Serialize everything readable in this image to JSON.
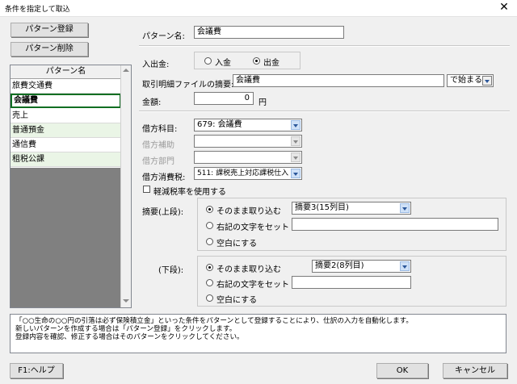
{
  "window": {
    "title": "条件を指定して取込",
    "close_glyph": "✕"
  },
  "left": {
    "register_button": "パターン登録",
    "delete_button": "パターン削除",
    "list_header": "パターン名",
    "items": [
      "旅費交通費",
      "会議費",
      "売上",
      "普通預金",
      "通信費",
      "租税公課"
    ],
    "selected_index": 1
  },
  "form": {
    "pattern_name_label": "パターン名:",
    "pattern_name_value": "会議費",
    "inout_label": "入出金:",
    "in_label": "入金",
    "out_label": "出金",
    "inout_selected": "出金",
    "summary_label": "取引明細ファイルの摘要:",
    "summary_value": "会議費",
    "match_value": "で始まる",
    "amount_label": "金額:",
    "amount_value": "0",
    "amount_unit": "円",
    "debit_account_label": "借方科目:",
    "debit_account_value": "679: 会議費",
    "debit_sub_label": "借方補助",
    "debit_sub_value": "",
    "debit_dept_label": "借方部門",
    "debit_dept_value": "",
    "debit_tax_label": "借方消費税:",
    "debit_tax_value": "511: 課税売上対応課税仕入",
    "reduced_tax_label": "軽減税率を使用する",
    "upper_label": "摘要(上段):",
    "lower_label": "(下段):",
    "opt_keep": "そのまま取り込む",
    "opt_set": "右記の文字をセット",
    "opt_blank": "空白にする",
    "upper_select_value": "摘要3(15列目)",
    "upper_text_value": "",
    "lower_select_value": "摘要2(8列目)",
    "lower_text_value": ""
  },
  "description": {
    "line1": "「○○生命の○○円の引落は必ず保険積立金」といった条件をパターンとして登録することにより、仕訳の入力を自動化します。",
    "line2": "新しいパターンを作成する場合は「パターン登録」をクリックします。",
    "line3": "登録内容を確認、修正する場合はそのパターンをクリックしてください。"
  },
  "footer": {
    "help_button": "F1:ヘルプ",
    "ok_button": "OK",
    "cancel_button": "キャンセル"
  },
  "colors": {
    "selected_border": "#0f6e22",
    "alt_row": "#eaf5e6",
    "list_empty": "#808080"
  }
}
